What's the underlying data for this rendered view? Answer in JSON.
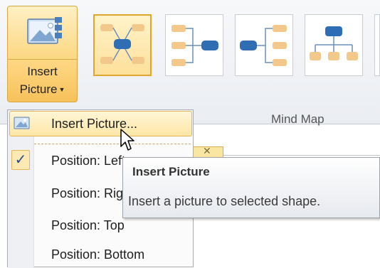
{
  "ribbon": {
    "insert_picture_button": {
      "line1": "Insert",
      "line2": "Picture"
    },
    "group_label": "Mind Map",
    "layouts": [
      "Mind Map (both sides)",
      "Right Map",
      "Left Map",
      "Org Chart"
    ]
  },
  "menu": {
    "items": [
      {
        "label": "Insert Picture..."
      },
      {
        "label": "Position: Left",
        "checked": true
      },
      {
        "label": "Position: Right"
      },
      {
        "label": "Position: Top"
      },
      {
        "label": "Position: Bottom"
      }
    ]
  },
  "tooltip": {
    "title": "Insert Picture",
    "description": "Insert a picture to selected shape."
  },
  "colors": {
    "accent_orange": "#e0a52b",
    "node_blue": "#2f6db5",
    "node_tan": "#f2c98a"
  }
}
